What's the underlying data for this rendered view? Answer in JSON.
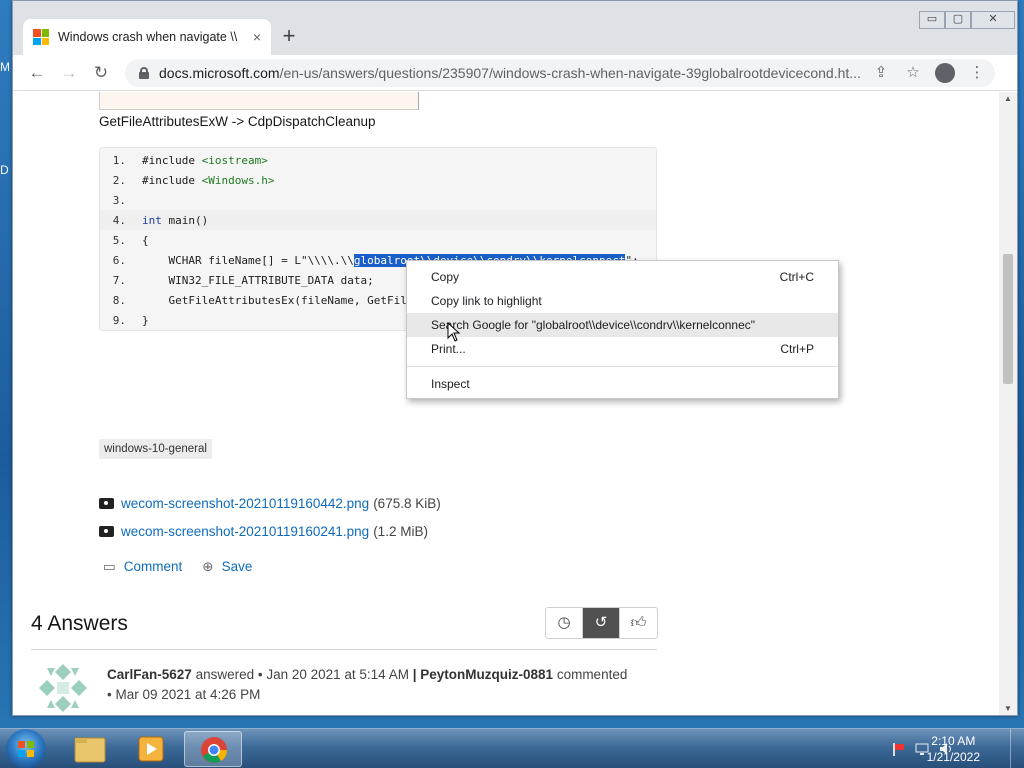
{
  "desktop": {
    "left_letters": [
      "M",
      "D"
    ]
  },
  "browser": {
    "tab": {
      "title": "Windows crash when navigate \\\\",
      "close": "×"
    },
    "new_tab": "+",
    "window_controls": {
      "minimize": "▭",
      "maximize": "▢",
      "close": "✕"
    },
    "nav": {
      "back": "←",
      "forward": "→",
      "reload": "↻"
    },
    "url_host": "docs.microsoft.com",
    "url_path": "/en-us/answers/questions/235907/windows-crash-when-navigate-39globalrootdevicecond.ht...",
    "omni_icons": {
      "share": "⇪",
      "star": "☆",
      "menu": "⋮"
    }
  },
  "page": {
    "function_chain": "GetFileAttributesExW -> CdpDispatchCleanup",
    "code_lines": [
      {
        "n": "1.",
        "parts": [
          {
            "t": "#include ",
            "c": "pp"
          },
          {
            "t": "<iostream>",
            "c": "str"
          }
        ]
      },
      {
        "n": "2.",
        "parts": [
          {
            "t": "#include ",
            "c": "pp"
          },
          {
            "t": "<Windows.h>",
            "c": "str"
          }
        ]
      },
      {
        "n": "3.",
        "parts": [
          {
            "t": "",
            "c": ""
          }
        ]
      },
      {
        "n": "4.",
        "parts": [
          {
            "t": "int",
            "c": "kw"
          },
          {
            "t": " main()",
            "c": ""
          }
        ]
      },
      {
        "n": "5.",
        "parts": [
          {
            "t": "{",
            "c": ""
          }
        ]
      },
      {
        "n": "6.",
        "parts": [
          {
            "t": "    WCHAR fileName[] = L\"\\\\\\\\.\\\\",
            "c": ""
          },
          {
            "t": "globalroot\\\\device\\\\condrv\\\\kernelconnect",
            "c": "sel"
          },
          {
            "t": "\";",
            "c": ""
          }
        ]
      },
      {
        "n": "7.",
        "parts": [
          {
            "t": "    WIN32_FILE_ATTRIBUTE_DATA data;",
            "c": ""
          }
        ]
      },
      {
        "n": "8.",
        "parts": [
          {
            "t": "    GetFileAttributesEx(fileName, GetFile",
            "c": ""
          }
        ]
      },
      {
        "n": "9.",
        "parts": [
          {
            "t": "}",
            "c": ""
          }
        ]
      }
    ],
    "tag": "windows-10-general",
    "attachments": [
      {
        "name": "wecom-screenshot-20210119160442.png",
        "size": "(675.8 KiB)"
      },
      {
        "name": "wecom-screenshot-20210119160241.png",
        "size": "(1.2 MiB)"
      }
    ],
    "actions": {
      "comment": "Comment",
      "save": "Save"
    },
    "answers": {
      "count": "4",
      "label": "Answers"
    },
    "sort_icons": [
      "clock-icon",
      "history-icon",
      "thumbs-up-icon"
    ],
    "answer": {
      "author": "CarlFan-5627",
      "verb": "answered",
      "date": "Jan 20 2021 at 5:14 AM",
      "sep": "|",
      "commenter": "PeytonMuzquiz-0881",
      "comment_verb": "commented",
      "comment_date": "Mar 09 2021 at 4:26 PM"
    }
  },
  "context_menu": {
    "items": [
      {
        "label": "Copy",
        "shortcut": "Ctrl+C"
      },
      {
        "label": "Copy link to highlight",
        "shortcut": ""
      },
      {
        "label": "Search Google for \"globalroot\\\\device\\\\condrv\\\\kernelconnec\"",
        "shortcut": ""
      },
      {
        "label": "Print...",
        "shortcut": "Ctrl+P"
      },
      {
        "label": "Inspect",
        "shortcut": ""
      }
    ]
  },
  "taskbar": {
    "time": "2:10 AM",
    "date": "1/21/2022"
  },
  "colors": {
    "link": "#0f6cbd",
    "selection": "#1a5ec9",
    "win_red": "#f25022",
    "win_green": "#7fba00",
    "win_blue": "#00a4ef",
    "win_yellow": "#ffb900"
  }
}
